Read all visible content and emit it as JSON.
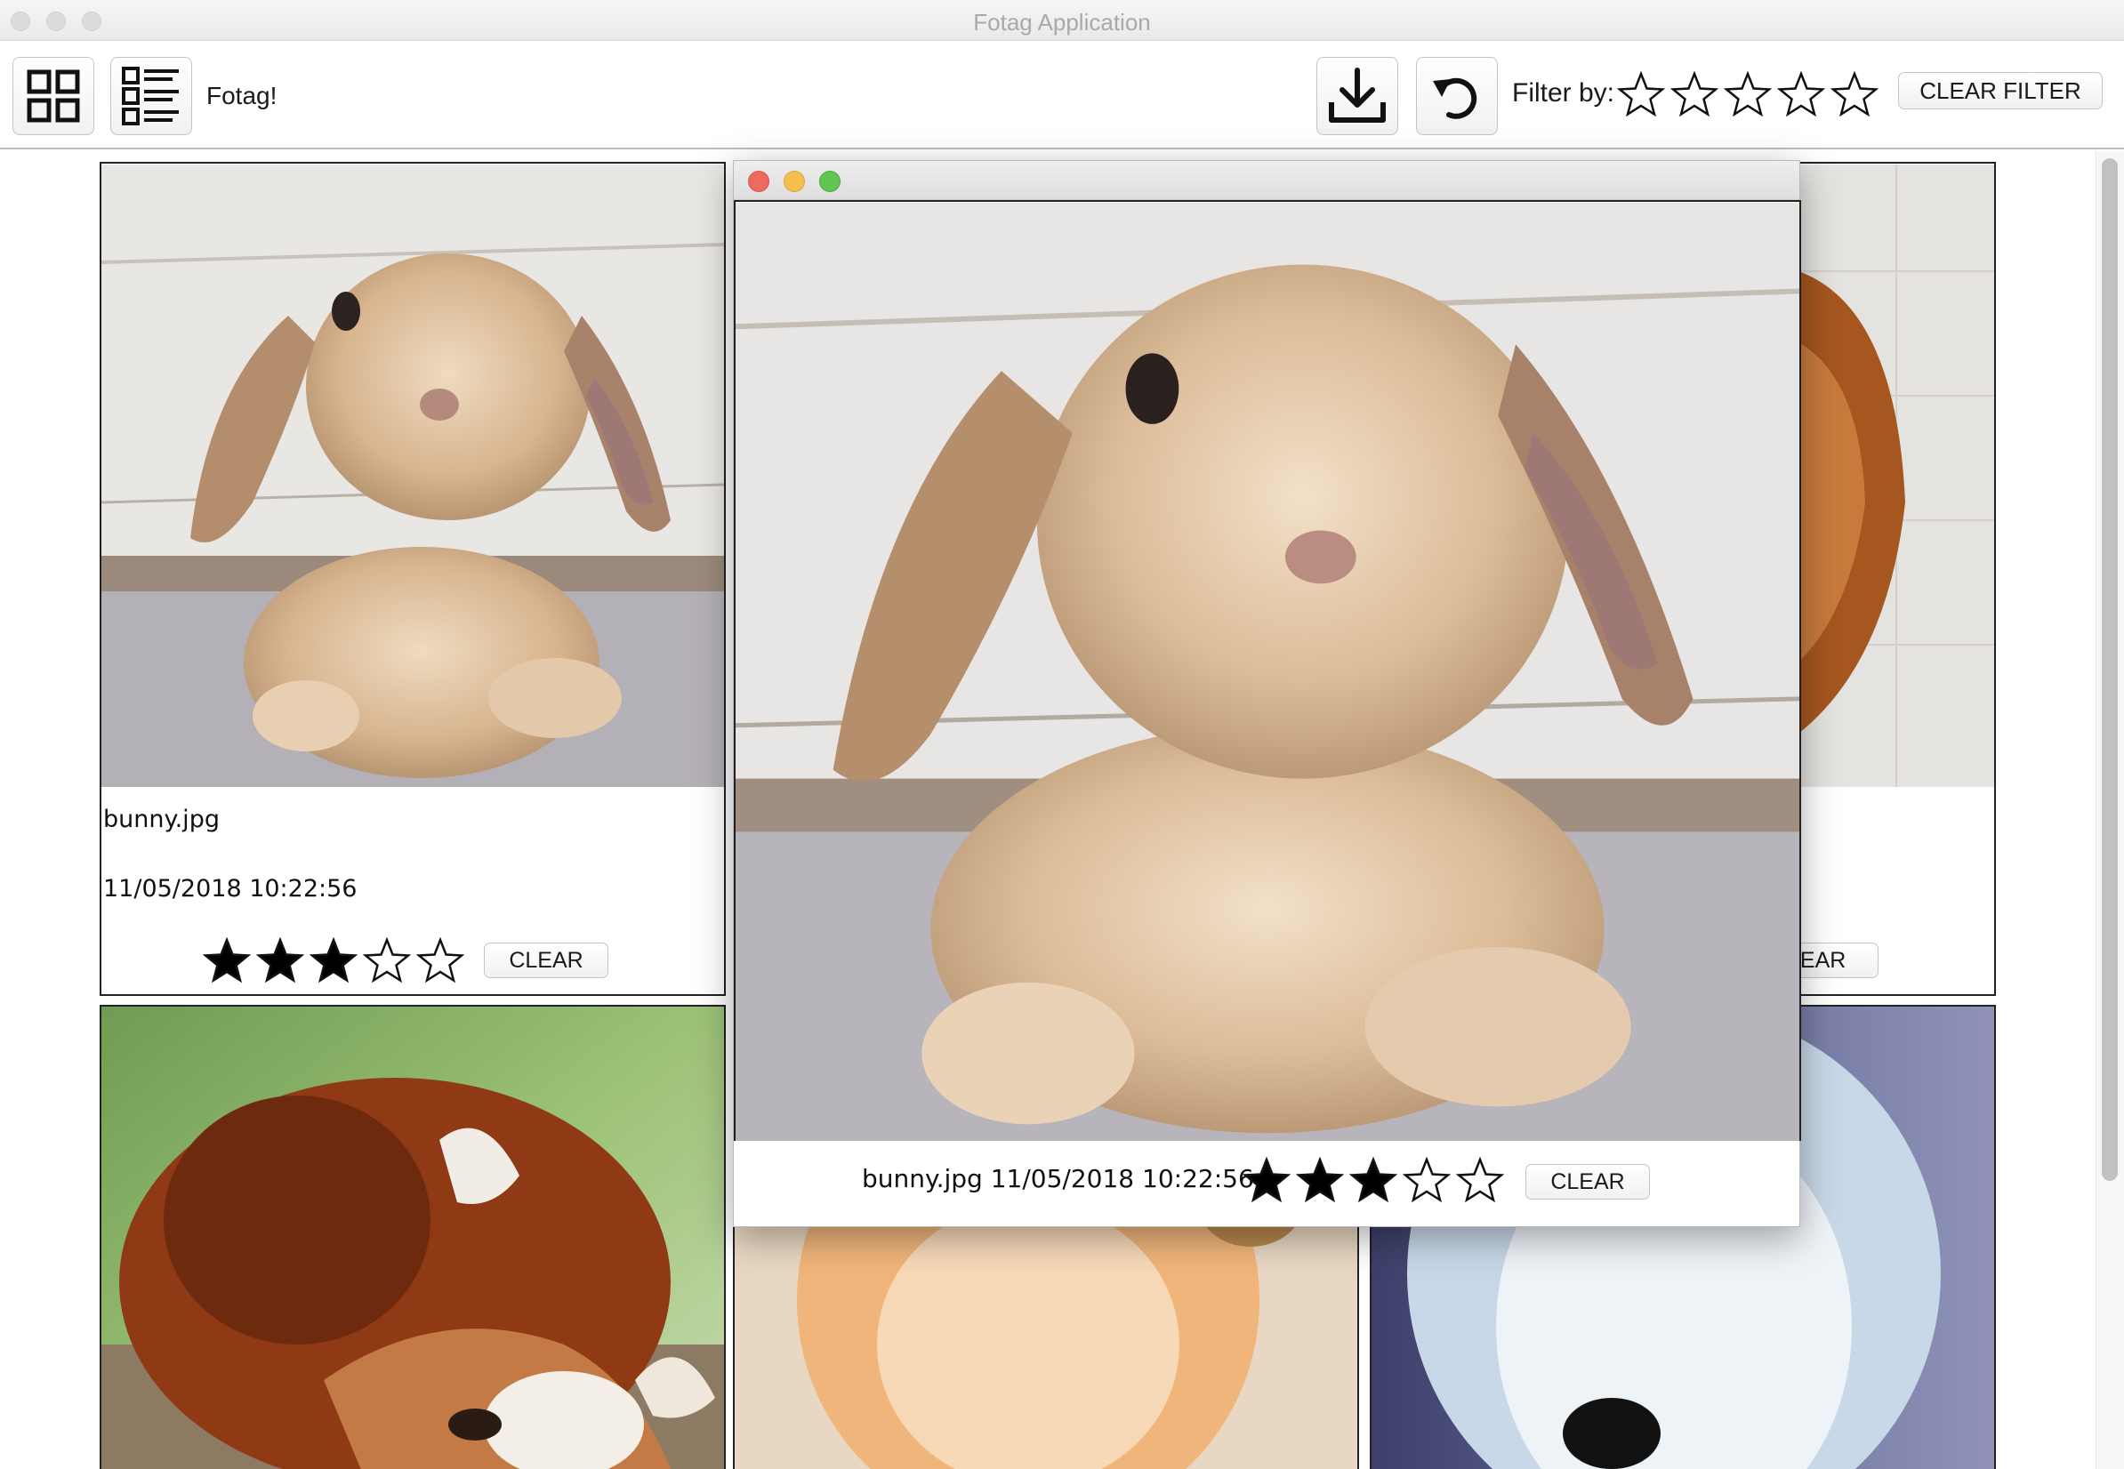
{
  "window": {
    "title": "Fotag Application"
  },
  "toolbar": {
    "app_name": "Fotag!",
    "grid_view_icon": "grid-view-icon",
    "list_view_icon": "list-view-icon",
    "load_icon": "download-icon",
    "undo_icon": "undo-icon",
    "filter_label": "Filter by:",
    "filter_rating": 0,
    "filter_max": 5,
    "clear_filter_label": "CLEAR FILTER"
  },
  "cards": [
    {
      "name": "bunny.jpg",
      "date": "11/05/2018 10:22:56",
      "rating": 3,
      "clear_label": "CLEAR"
    },
    {
      "name": "",
      "date": "",
      "rating": 0,
      "clear_label": "LEAR"
    }
  ],
  "preview": {
    "caption": "bunny.jpg 11/05/2018 10:22:56",
    "rating": 3,
    "clear_label": "CLEAR"
  },
  "colors": {
    "close": "#ed6a5e",
    "minimize": "#f5bf4f",
    "maximize": "#61c554",
    "star_fill": "#000000"
  }
}
